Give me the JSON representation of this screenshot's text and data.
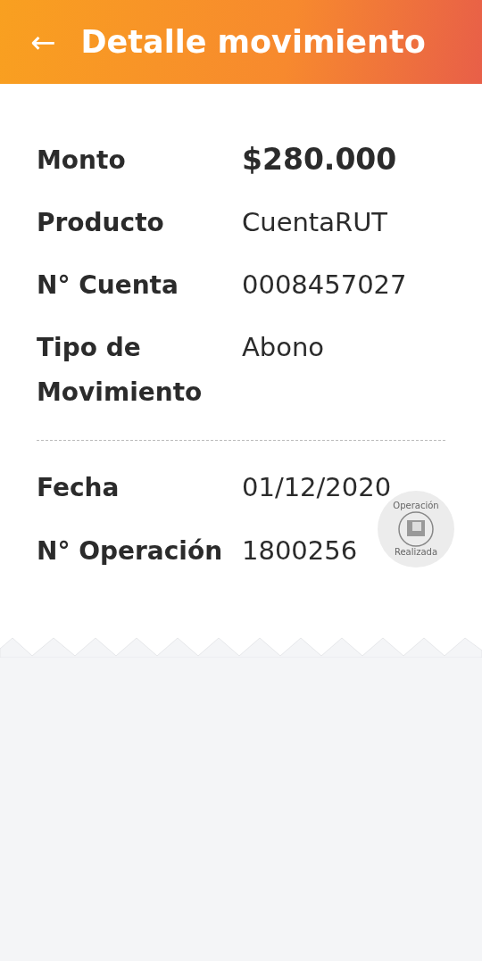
{
  "header": {
    "back_icon": "←",
    "title": "Detalle movimiento"
  },
  "details": [
    {
      "label": "Monto",
      "value": "$280.000",
      "kind": "amount"
    },
    {
      "label": "Producto",
      "value": "CuentaRUT",
      "kind": "plain"
    },
    {
      "label": "N° Cuenta",
      "value": "0008457027",
      "kind": "plain"
    },
    {
      "label": "Tipo de Movimiento",
      "value": "Abono",
      "kind": "plain"
    }
  ],
  "operation": [
    {
      "label": "Fecha",
      "value": "01/12/2020"
    },
    {
      "label": "N° Operación",
      "value": "1800256"
    }
  ],
  "stamp": {
    "top_text": "Operación",
    "bottom_text": "Realizada"
  }
}
